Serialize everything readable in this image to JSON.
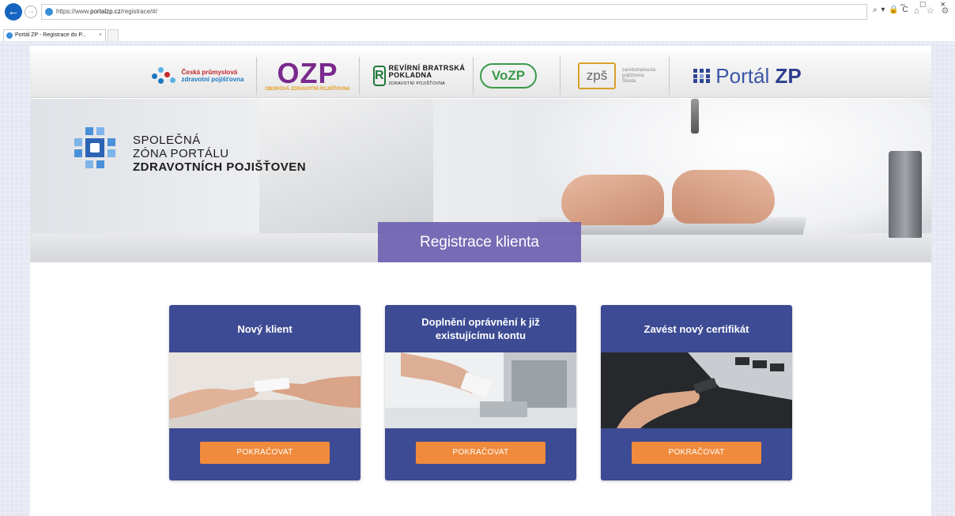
{
  "browser": {
    "back_icon": "back-arrow-icon",
    "forward_icon": "forward-arrow-icon",
    "url_scheme": "https://www.",
    "url_domain": "portalzp.cz",
    "url_path": "/registrace/#/",
    "address_tools": "⌕ ▾ 🔒 C",
    "toolbar_icons": "⌂ ☆ ⚙",
    "window_controls": "– □ ×",
    "tab_title": "Portál ZP - Registrace do P...",
    "tab_close": "×"
  },
  "insurers": {
    "cpzp": {
      "line1": "Česká průmyslová",
      "line2": "zdravotní pojišťovna"
    },
    "ozp": {
      "name": "OZP",
      "subtitle": "OBOROVÁ ZDRAVOTNÍ POJIŠŤOVNA"
    },
    "rbp": {
      "mark": "R",
      "name": "REVÍRNÍ BRATRSKÁ POKLADNA",
      "subtitle": "ZDRAVOTNÍ POJIŠŤOVNA"
    },
    "vozp": {
      "name": "VoZP"
    },
    "zps": {
      "mark": "zpš",
      "subtitle": "zaměstnanecká pojišťovna Škoda"
    },
    "portal": {
      "name_light": "Portál ",
      "name_bold": "ZP"
    }
  },
  "hero": {
    "zone_line1": "SPOLEČNÁ",
    "zone_line2": "ZÓNA PORTÁLU",
    "zone_line3": "ZDRAVOTNÍCH POJIŠŤOVEN",
    "title": "Registrace klienta"
  },
  "cards": [
    {
      "title": "Nový klient",
      "button": "POKRAČOVAT",
      "image": "handing-card-photo"
    },
    {
      "title": "Doplnění oprávnění k již existujícímu kontu",
      "button": "POKRAČOVAT",
      "image": "card-at-terminal-photo"
    },
    {
      "title": "Zavést nový certifikát",
      "button": "POKRAČOVAT",
      "image": "usb-key-laptop-photo"
    }
  ],
  "colors": {
    "card_background": "#3d4b94",
    "hero_title_background": "#6f62b2",
    "button_orange": "#f08a3c"
  }
}
